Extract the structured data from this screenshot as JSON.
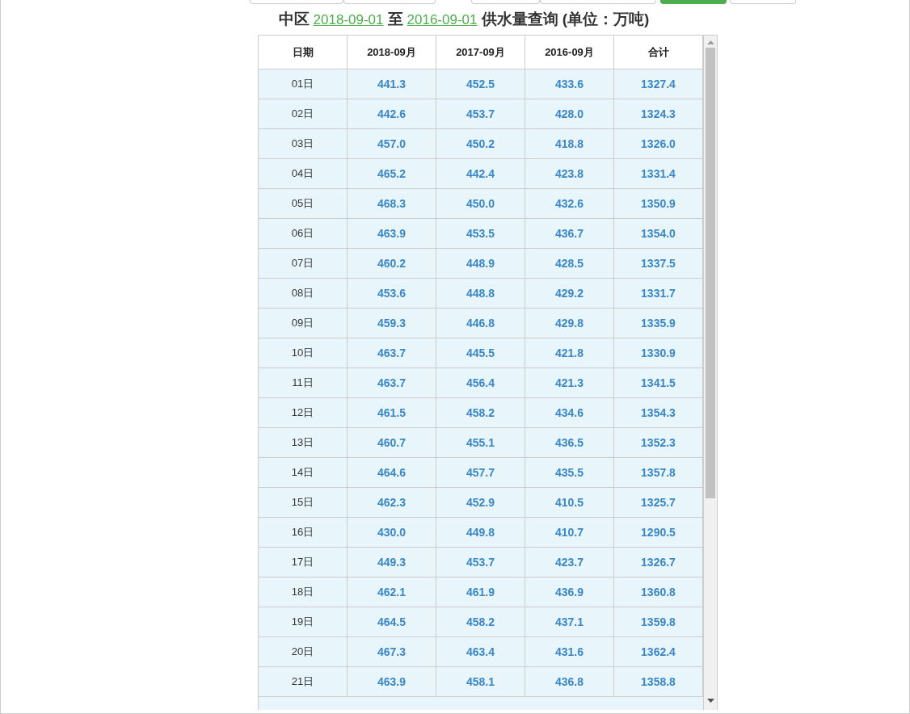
{
  "tabs": [
    {
      "selected": false
    },
    {
      "selected": false
    },
    {
      "selected": false
    },
    {
      "selected": false
    },
    {
      "selected": true
    },
    {
      "selected": false
    }
  ],
  "title": {
    "district": "中区",
    "start_date": "2018-09-01",
    "connector": "至",
    "end_date": "2016-09-01",
    "suffix": "供水量查询 (单位：万吨)"
  },
  "table": {
    "columns": [
      "日期",
      "2018-09月",
      "2017-09月",
      "2016-09月",
      "合计"
    ],
    "rows": [
      [
        "01日",
        "441.3",
        "452.5",
        "433.6",
        "1327.4"
      ],
      [
        "02日",
        "442.6",
        "453.7",
        "428.0",
        "1324.3"
      ],
      [
        "03日",
        "457.0",
        "450.2",
        "418.8",
        "1326.0"
      ],
      [
        "04日",
        "465.2",
        "442.4",
        "423.8",
        "1331.4"
      ],
      [
        "05日",
        "468.3",
        "450.0",
        "432.6",
        "1350.9"
      ],
      [
        "06日",
        "463.9",
        "453.5",
        "436.7",
        "1354.0"
      ],
      [
        "07日",
        "460.2",
        "448.9",
        "428.5",
        "1337.5"
      ],
      [
        "08日",
        "453.6",
        "448.8",
        "429.2",
        "1331.7"
      ],
      [
        "09日",
        "459.3",
        "446.8",
        "429.8",
        "1335.9"
      ],
      [
        "10日",
        "463.7",
        "445.5",
        "421.8",
        "1330.9"
      ],
      [
        "11日",
        "463.7",
        "456.4",
        "421.3",
        "1341.5"
      ],
      [
        "12日",
        "461.5",
        "458.2",
        "434.6",
        "1354.3"
      ],
      [
        "13日",
        "460.7",
        "455.1",
        "436.5",
        "1352.3"
      ],
      [
        "14日",
        "464.6",
        "457.7",
        "435.5",
        "1357.8"
      ],
      [
        "15日",
        "462.3",
        "452.9",
        "410.5",
        "1325.7"
      ],
      [
        "16日",
        "430.0",
        "449.8",
        "410.7",
        "1290.5"
      ],
      [
        "17日",
        "449.3",
        "453.7",
        "423.7",
        "1326.7"
      ],
      [
        "18日",
        "462.1",
        "461.9",
        "436.9",
        "1360.8"
      ],
      [
        "19日",
        "464.5",
        "458.2",
        "437.1",
        "1359.8"
      ],
      [
        "20日",
        "467.3",
        "463.4",
        "431.6",
        "1362.4"
      ],
      [
        "21日",
        "463.9",
        "458.1",
        "436.8",
        "1358.8"
      ]
    ]
  }
}
